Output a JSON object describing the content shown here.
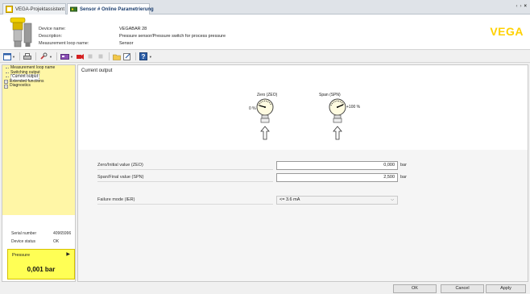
{
  "tabs": [
    {
      "label": "VEGA-Projektassistent"
    },
    {
      "label": "Sensor # Online Parametrierung"
    }
  ],
  "window_controls": {
    "prev": "‹",
    "next": "›",
    "close": "×"
  },
  "header": {
    "device_name_label": "Device name:",
    "device_name": "VEGABAR 28",
    "description_label": "Description:",
    "description": "Pressure sensor/Pressure switch for process pressure",
    "loop_label": "Measurement loop name:",
    "loop_name": "Sensor",
    "logo": "VEGA"
  },
  "toolbar": {
    "icons": [
      "view-icon",
      "print-icon",
      "wrench-icon",
      "device-icon",
      "record-icon",
      "stop-icon",
      "pause-icon",
      "folder-icon",
      "edit-icon",
      "help-icon"
    ]
  },
  "tree": {
    "items": [
      {
        "label": "Measurement loop name"
      },
      {
        "label": "Switching output"
      },
      {
        "label": "Current output"
      },
      {
        "label": "Extended functions"
      },
      {
        "label": "Diagnostics"
      }
    ]
  },
  "device_info": {
    "serial_label": "Serial number",
    "serial_value": "40965996",
    "status_label": "Device status",
    "status_value": "OK"
  },
  "pressure": {
    "label": "Pressure",
    "value": "0,001 bar"
  },
  "main": {
    "title": "Current output",
    "gauge_zero_label": "Zero (ZEO)",
    "gauge_zero_pct": "0 %",
    "gauge_span_label": "Span (SPN)",
    "gauge_span_pct": "+100 %",
    "zero_label": "Zero/Initial value (ZEO)",
    "zero_value": "0,000",
    "zero_unit": "bar",
    "span_label": "Span/Final value (SPN)",
    "span_value": "2,500",
    "span_unit": "bar",
    "failure_label": "Failure mode (IER)",
    "failure_value": "<= 3.6 mA"
  },
  "buttons": {
    "ok": "OK",
    "cancel": "Cancel",
    "apply": "Apply"
  },
  "colors": {
    "accent_yellow": "#ffff55",
    "tree_bg": "#fff6a6",
    "logo_yellow": "#ffd100",
    "tab_text": "#1a3d6e"
  }
}
